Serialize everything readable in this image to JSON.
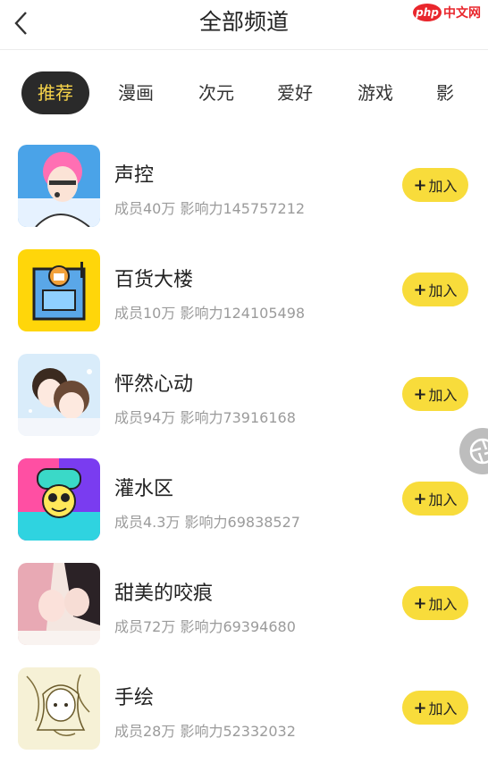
{
  "header": {
    "title": "全部频道",
    "watermark_php": "php",
    "watermark_cn": "中文网"
  },
  "tabs": [
    {
      "label": "推荐",
      "active": true
    },
    {
      "label": "漫画"
    },
    {
      "label": "次元"
    },
    {
      "label": "爱好"
    },
    {
      "label": "游戏"
    },
    {
      "label": "影"
    }
  ],
  "channels": [
    {
      "name": "声控",
      "meta": "成员40万 影响力145757212",
      "join": "加入"
    },
    {
      "name": "百货大楼",
      "meta": "成员10万 影响力124105498",
      "join": "加入"
    },
    {
      "name": "怦然心动",
      "meta": "成员94万 影响力73916168",
      "join": "加入"
    },
    {
      "name": "灌水区",
      "meta": "成员4.3万 影响力69838527",
      "join": "加入"
    },
    {
      "name": "甜美的咬痕",
      "meta": "成员72万 影响力69394680",
      "join": "加入"
    },
    {
      "name": "手绘",
      "meta": "成员28万 影响力52332032",
      "join": "加入"
    }
  ],
  "colors": {
    "accent": "#f8dc3b",
    "tab_active_bg": "#2a2a2a",
    "tab_active_text": "#f7d44a"
  }
}
